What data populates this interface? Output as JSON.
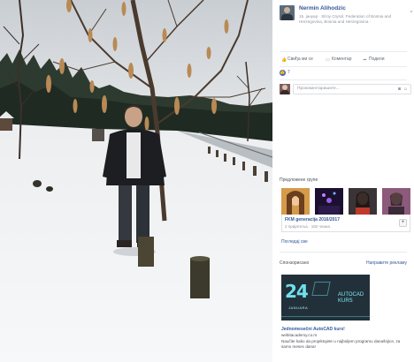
{
  "photo": {
    "alt_subject": "snow-photo"
  },
  "post": {
    "author_name": "Nermin Alihodzic",
    "subtitle": "15. јануар · Stroy Crysol, Federation of Bosnia and Herzegovina, Bosnia and Herzegovina · ",
    "menu_chevron": "⌄"
  },
  "actions": {
    "like_label": "Свиђа ми се",
    "comment_label": "Коментар",
    "share_label": "Подели"
  },
  "reactions": {
    "like_count": "7"
  },
  "comment": {
    "placeholder": "Прокоментаришите..."
  },
  "suggested_groups": {
    "title": "Предложене групе",
    "group_name": "FKM generacija 2016/2017",
    "group_meta": "2 пријатеља · 182 члана",
    "add_label": "+",
    "see_all": "Погледај све"
  },
  "ad": {
    "sponsored_label": "Спонзорисано",
    "create_ad_label": "Направите рекламу",
    "big_number": "24",
    "month": "JANUARA",
    "brand_line1": "AUTOCAD",
    "brand_line2": "KURS",
    "title": "Jednomesečni AutoCAD kurs!",
    "url": "webitacademy.co.rs",
    "description": "Naučite kako da projektujete u najboljem programu današnjice, za samo mesec dana!"
  },
  "colors": {
    "link_blue": "#365899",
    "like_blue": "#4267b2",
    "ad_cyan": "#6fe0ec"
  }
}
